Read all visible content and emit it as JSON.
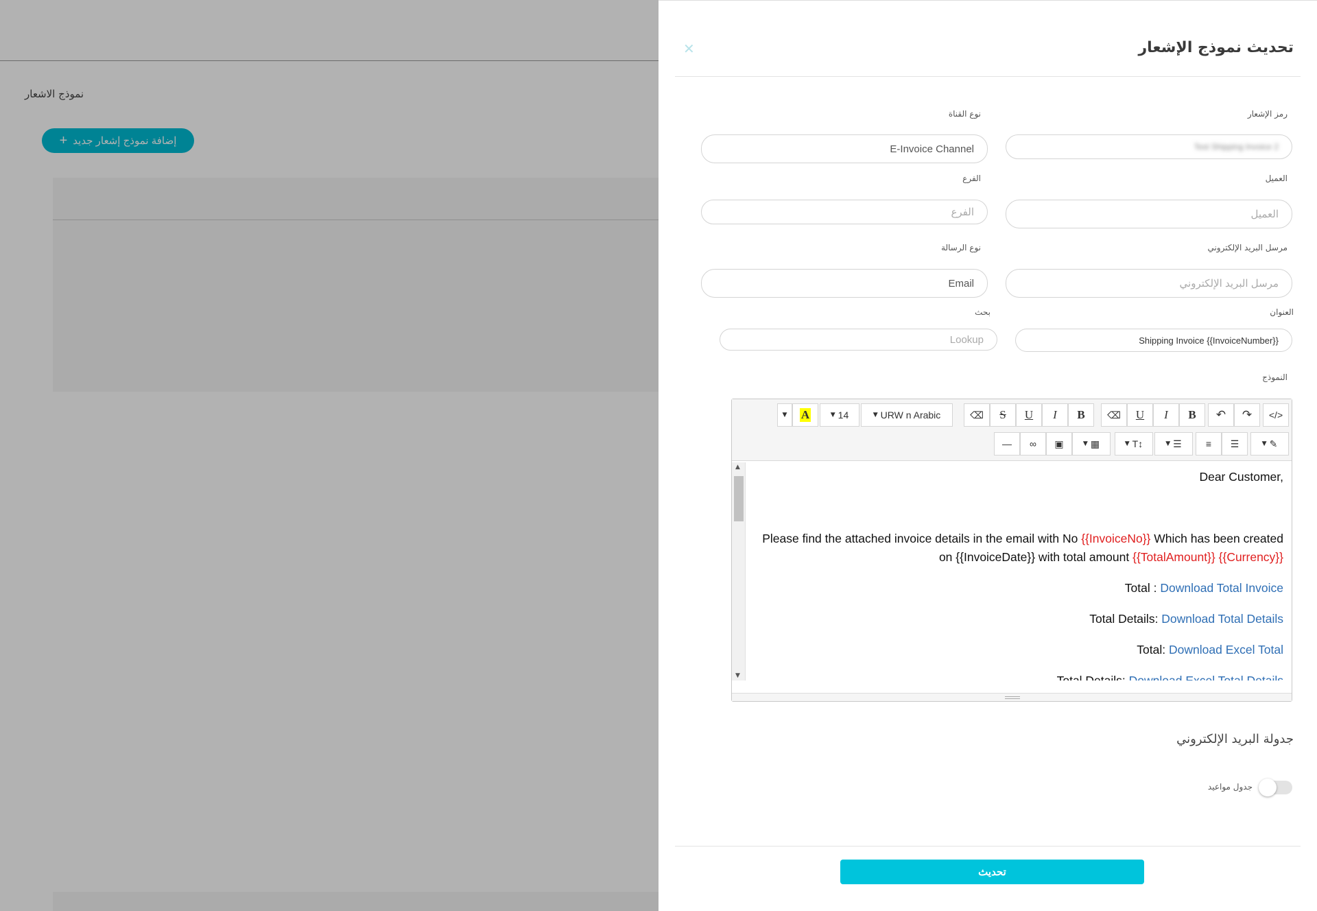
{
  "background": {
    "page_title": "نموذج الاشعار",
    "add_button_label": "إضافة نموذج إشعار جديد",
    "add_button_icon": "plus-icon"
  },
  "drawer": {
    "title": "تحديث نموذج الإشعار",
    "close_icon": "close-icon",
    "fields": {
      "notification_code": {
        "label": "رمز الإشعار",
        "value": "Test Shipping Invoice 2"
      },
      "channel_type": {
        "label": "نوع القناة",
        "value": "E-Invoice Channel"
      },
      "customer": {
        "label": "العميل",
        "placeholder": "العميل"
      },
      "branch": {
        "label": "الفرع",
        "placeholder": "الفرع"
      },
      "email_sender": {
        "label": "مرسل البريد الإلكتروني",
        "placeholder": "مرسل البريد الإلكتروني"
      },
      "message_type": {
        "label": "نوع الرسالة",
        "value": "Email"
      },
      "subject": {
        "label": "العنوان",
        "value": "Shipping Invoice {{InvoiceNumber}}"
      },
      "search": {
        "label": "بحث",
        "placeholder": "Lookup"
      }
    },
    "template_label": "النموذج",
    "editor": {
      "toolbar": {
        "font_name": "URW n Arabic",
        "font_size": "14",
        "code_view": "</>",
        "bold": "B",
        "italic": "I",
        "underline": "U",
        "strikethrough": "S",
        "highlight": "A"
      },
      "content": {
        "greeting": "Dear Customer,",
        "line1_a": "Please find the attached invoice details in the email with No ",
        "line1_var1": "{{InvoiceNo}}",
        "line1_b": " Which has been created on {{InvoiceDate}} with total amount ",
        "line1_var2": "{{TotalAmount}}",
        "line1_var3": "{{Currency}}",
        "total_label": "Total : ",
        "total_link": "Download Total Invoice",
        "total_details_label": "Total Details: ",
        "total_details_link": "Download Total Details",
        "excel_total_label": "Total: ",
        "excel_total_link": "Download Excel Total",
        "excel_details_label": "Total Details: ",
        "excel_details_link": "Download Excel Total Details"
      }
    },
    "email_schedule_title": "جدولة البريد الإلكتروني",
    "schedule_toggle_label": "جدول مواعيد",
    "schedule_enabled": false,
    "update_button": "تحديث",
    "accent_color": "#00c4dc"
  }
}
